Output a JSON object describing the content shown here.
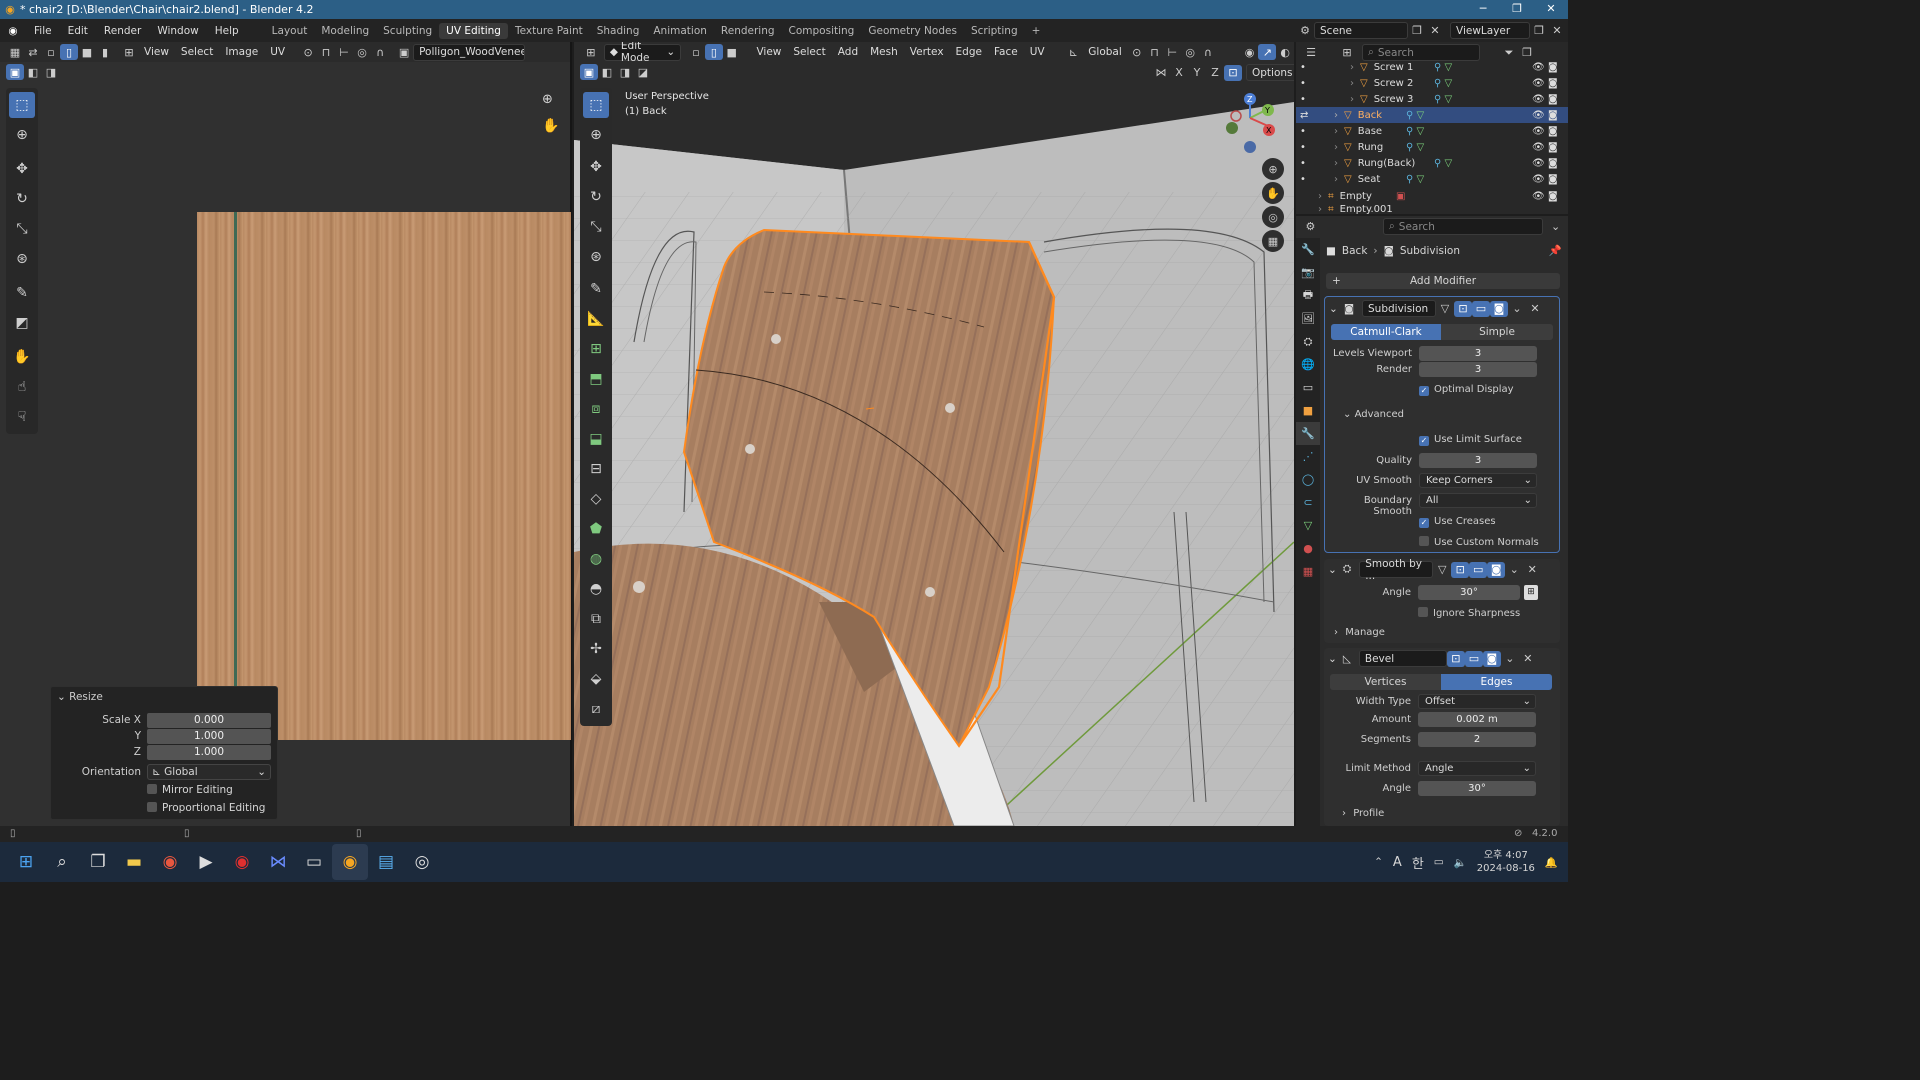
{
  "window": {
    "title": "* chair2 [D:\\Blender\\Chair\\chair2.blend] - Blender 4.2",
    "controls": [
      "─",
      "❐",
      "✕"
    ]
  },
  "topbar": {
    "menus": [
      "File",
      "Edit",
      "Render",
      "Window",
      "Help"
    ],
    "workspaces": [
      "Layout",
      "Modeling",
      "Sculpting",
      "UV Editing",
      "Texture Paint",
      "Shading",
      "Animation",
      "Rendering",
      "Compositing",
      "Geometry Nodes",
      "Scripting"
    ],
    "active_workspace": "UV Editing",
    "add_label": "+",
    "scene": "Scene",
    "view_layer": "ViewLayer"
  },
  "uv_editor": {
    "menus": [
      "View",
      "Select",
      "Image",
      "UV"
    ],
    "image_name": "Polligon_WoodVeneerOa",
    "resize_panel": {
      "title": "Resize",
      "scale_x_label": "Scale X",
      "scale_x": "0.000",
      "y_label": "Y",
      "y": "1.000",
      "z_label": "Z",
      "z": "1.000",
      "orientation_label": "Orientation",
      "orientation": "Global",
      "mirror_editing": "Mirror Editing",
      "proportional_editing": "Proportional Editing"
    }
  },
  "viewport": {
    "mode": "Edit Mode",
    "menus": [
      "View",
      "Select",
      "Add",
      "Mesh",
      "Vertex",
      "Edge",
      "Face",
      "UV"
    ],
    "orientation": "Global",
    "options_label": "Options",
    "axes_xyz": [
      "X",
      "Y",
      "Z"
    ],
    "overlay_line1": "User Perspective",
    "overlay_line2": "(1) Back",
    "gizmo": {
      "z": "Z",
      "y": "Y",
      "x": "X"
    }
  },
  "outliner": {
    "search_placeholder": "Search",
    "items": [
      {
        "name": "Screw 1",
        "selected": false
      },
      {
        "name": "Screw 2",
        "selected": false
      },
      {
        "name": "Screw 3",
        "selected": false
      },
      {
        "name": "Back",
        "selected": true
      },
      {
        "name": "Base",
        "selected": false
      },
      {
        "name": "Rung",
        "selected": false
      },
      {
        "name": "Rung(Back)",
        "selected": false
      },
      {
        "name": "Seat",
        "selected": false
      },
      {
        "name": "Empty",
        "selected": false
      },
      {
        "name": "Empty.001",
        "selected": false
      }
    ]
  },
  "properties": {
    "search_placeholder": "Search",
    "breadcrumb_object": "Back",
    "breadcrumb_modifier": "Subdivision",
    "add_modifier": "Add Modifier",
    "subdivision": {
      "name": "Subdivision",
      "tab_catmull": "Catmull-Clark",
      "tab_simple": "Simple",
      "levels_viewport_label": "Levels Viewport",
      "levels_viewport": "3",
      "render_label": "Render",
      "render": "3",
      "optimal_display": "Optimal Display",
      "advanced": "Advanced",
      "use_limit_surface": "Use Limit Surface",
      "quality_label": "Quality",
      "quality": "3",
      "uv_smooth_label": "UV Smooth",
      "uv_smooth": "Keep Corners",
      "boundary_smooth_label": "Boundary Smooth",
      "boundary_smooth": "All",
      "use_creases": "Use Creases",
      "use_custom_normals": "Use Custom Normals"
    },
    "smooth": {
      "name": "Smooth by ...",
      "angle_label": "Angle",
      "angle": "30°",
      "ignore_sharpness": "Ignore Sharpness",
      "manage": "Manage"
    },
    "bevel": {
      "name": "Bevel",
      "tab_vertices": "Vertices",
      "tab_edges": "Edges",
      "width_type_label": "Width Type",
      "width_type": "Offset",
      "amount_label": "Amount",
      "amount": "0.002 m",
      "segments_label": "Segments",
      "segments": "2",
      "limit_method_label": "Limit Method",
      "limit_method": "Angle",
      "angle_label": "Angle",
      "angle": "30°",
      "profile": "Profile"
    }
  },
  "status": {
    "version": "4.2.0"
  },
  "taskbar": {
    "time_line1": "오후 4:07",
    "time_line2": "2024-08-16",
    "ime": "A",
    "hangul": "한"
  },
  "colors": {
    "accent": "#4772b3",
    "selection_outline": "#ff8a1f",
    "titlebar": "#2c5f86"
  }
}
